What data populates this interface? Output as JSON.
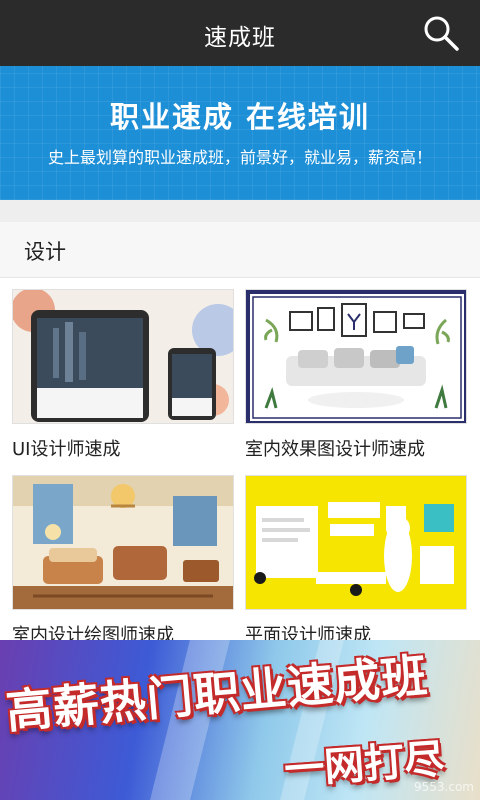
{
  "header": {
    "title": "速成班",
    "search_icon": "search-icon"
  },
  "banner": {
    "headline": "职业速成 在线培训",
    "subtitle": "史上最划算的职业速成班，前景好，就业易，薪资高！"
  },
  "section": {
    "title": "设计"
  },
  "courses": [
    {
      "label": "UI设计师速成",
      "image": "tablet-phone-mockup"
    },
    {
      "label": "室内效果图设计师速成",
      "image": "living-room-sofa-illustration"
    },
    {
      "label": "室内设计绘图师速成",
      "image": "interior-sketch-rendering"
    },
    {
      "label": "平面设计师速成",
      "image": "yellow-brand-stationery"
    }
  ],
  "promo": {
    "headline": "高薪热门职业速成班",
    "tagline": "一网打尽",
    "watermark": "9553.com"
  },
  "colors": {
    "topbar": "#2b2b2b",
    "banner": "#1d8fd6",
    "promo_outline": "#c42a2a"
  }
}
